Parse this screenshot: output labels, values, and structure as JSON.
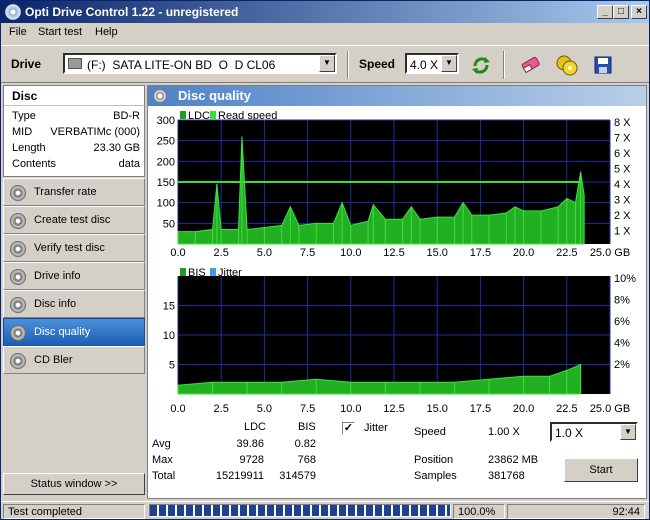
{
  "window": {
    "title": "Opti Drive Control 1.22 - unregistered"
  },
  "menu": [
    "File",
    "Start test",
    "Help"
  ],
  "toolbar": {
    "drive_label": "Drive",
    "drive_value": "(F:)  SATA LITE-ON BD  O  D CL06",
    "speed_label": "Speed",
    "speed_value": "4.0 X",
    "icons": [
      "refresh-icon",
      "eraser-icon",
      "disc-copy-icon",
      "save-icon"
    ]
  },
  "disc": {
    "header": "Disc",
    "rows": [
      {
        "key": "Type",
        "value": "BD-R"
      },
      {
        "key": "MID",
        "value": "VERBATIMc (000)"
      },
      {
        "key": "Length",
        "value": "23.30 GB"
      },
      {
        "key": "Contents",
        "value": "data"
      }
    ]
  },
  "nav": [
    {
      "label": "Transfer rate",
      "active": false
    },
    {
      "label": "Create test disc",
      "active": false
    },
    {
      "label": "Verify test disc",
      "active": false
    },
    {
      "label": "Drive info",
      "active": false
    },
    {
      "label": "Disc info",
      "active": false
    },
    {
      "label": "Disc quality",
      "active": true
    },
    {
      "label": "CD Bler",
      "active": false
    }
  ],
  "status_window_button": "Status window >>",
  "panel_title": "Disc quality",
  "chart_data": [
    {
      "type": "line",
      "legend": [
        "LDC",
        "Read speed"
      ],
      "x_ticks": [
        "0.0",
        "2.5",
        "5.0",
        "7.5",
        "10.0",
        "12.5",
        "15.0",
        "17.5",
        "20.0",
        "22.5",
        "25.0"
      ],
      "x_unit": "GB",
      "xlim": [
        0,
        25
      ],
      "ylim": [
        0,
        300
      ],
      "y_ticks": [
        "300",
        "250",
        "200",
        "150",
        "100",
        "50"
      ],
      "y2_ticks": [
        "8 X",
        "7 X",
        "6 X",
        "5 X",
        "4 X",
        "3 X",
        "2 X",
        "1 X"
      ],
      "y2lim": [
        0,
        8
      ],
      "grid": true,
      "series": [
        {
          "name": "LDC",
          "x": [
            0.0,
            1.0,
            2.0,
            2.25,
            2.5,
            3.5,
            3.7,
            4.0,
            5.0,
            6.0,
            6.5,
            7.0,
            8.0,
            9.0,
            9.5,
            10.0,
            11.0,
            11.3,
            12.0,
            13.0,
            13.5,
            14.0,
            15.0,
            16.0,
            16.5,
            17.0,
            18.0,
            19.0,
            19.5,
            20.0,
            21.0,
            22.0,
            22.5,
            23.0,
            23.3,
            23.5
          ],
          "y": [
            30,
            30,
            35,
            145,
            35,
            35,
            260,
            35,
            40,
            45,
            90,
            45,
            50,
            50,
            100,
            45,
            55,
            95,
            60,
            60,
            90,
            60,
            65,
            65,
            100,
            70,
            70,
            75,
            90,
            80,
            80,
            90,
            110,
            100,
            175,
            120
          ]
        },
        {
          "name": "Read speed",
          "x": [
            0.0,
            5.0,
            10.0,
            15.0,
            20.0,
            23.3
          ],
          "y": [
            4.0,
            4.0,
            4.0,
            4.0,
            4.0,
            4.0
          ]
        }
      ]
    },
    {
      "type": "line",
      "legend": [
        "BIS",
        "Jitter"
      ],
      "x_ticks": [
        "0.0",
        "2.5",
        "5.0",
        "7.5",
        "10.0",
        "12.5",
        "15.0",
        "17.5",
        "20.0",
        "22.5",
        "25.0"
      ],
      "x_unit": "GB",
      "xlim": [
        0,
        25
      ],
      "ylim": [
        0,
        20
      ],
      "y_ticks": [
        "15",
        "10",
        "5"
      ],
      "y2_ticks": [
        "10%",
        "8%",
        "6%",
        "4%",
        "2%"
      ],
      "grid": true,
      "series": [
        {
          "name": "BIS",
          "x": [
            0.0,
            2.0,
            4.0,
            6.0,
            8.0,
            10.0,
            12.0,
            14.0,
            16.0,
            18.0,
            20.0,
            21.5,
            22.5,
            23.3
          ],
          "y": [
            1.5,
            2,
            2,
            2,
            2.5,
            2,
            2,
            2,
            2,
            2.5,
            3,
            3,
            4,
            5
          ]
        }
      ]
    }
  ],
  "stats": {
    "col_ldc": "LDC",
    "col_bis": "BIS",
    "jitter_label": "Jitter",
    "jitter_checked": "✓",
    "rows": [
      {
        "label": "Avg",
        "ldc": "39.86",
        "bis": "0.82"
      },
      {
        "label": "Max",
        "ldc": "9728",
        "bis": "768"
      },
      {
        "label": "Total",
        "ldc": "15219911",
        "bis": "314579"
      }
    ],
    "speed_label": "Speed",
    "speed_value": "1.00 X",
    "speed_select": "1.0 X",
    "position_label": "Position",
    "position_value": "23862 MB",
    "samples_label": "Samples",
    "samples_value": "381768",
    "start_button": "Start"
  },
  "statusbar": {
    "text": "Test completed",
    "progress_percent": 100,
    "percent_text": "100.0%",
    "time": "92:44"
  }
}
